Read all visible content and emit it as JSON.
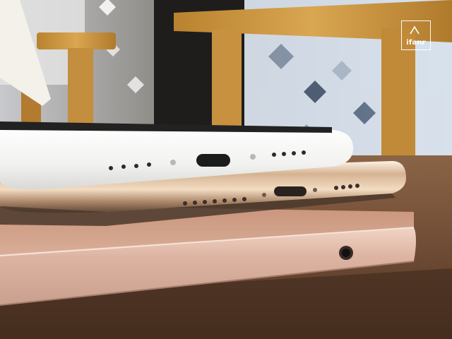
{
  "watermark": {
    "brand_text": "ifanr"
  },
  "scene": {
    "subjects": [
      "white-phone-top",
      "gold-phone-middle",
      "rose-gold-laptop-bottom"
    ],
    "colors": {
      "table": "#6f4c35",
      "laptop": "#d7aa95",
      "laptop_edge": "#f0d0c0",
      "gold_phone": "#e8c7a9",
      "white_phone": "#f3f3f1",
      "background_wood": "#c9973d",
      "background_tile": "#d6e0ec",
      "port": "#1d1d1d"
    }
  }
}
